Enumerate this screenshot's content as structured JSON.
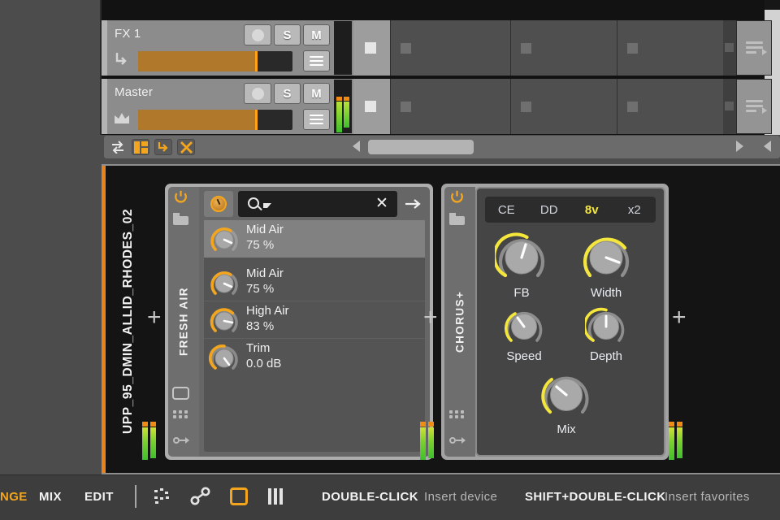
{
  "window": {
    "accent_orange": "#f3a61d",
    "accent_yellow": "#f5e63c"
  },
  "mixer": {
    "tracks": [
      {
        "name": "FX 1",
        "icon": "arrow-down-bend-icon",
        "rec_label": "",
        "solo_label": "S",
        "mute_label": "M",
        "menu_label": "list-icon",
        "fader_percent": 76,
        "meter_active": false
      },
      {
        "name": "Master",
        "icon": "crown-icon",
        "rec_label": "",
        "solo_label": "S",
        "mute_label": "M",
        "menu_label": "list-icon",
        "fader_percent": 76,
        "meter_active": true
      }
    ]
  },
  "toolbar": {
    "icons": [
      {
        "name": "swap-arrows-icon",
        "active": false
      },
      {
        "name": "track-list-icon",
        "active": true
      },
      {
        "name": "arrow-down-bend-icon",
        "active": false
      },
      {
        "name": "close-x-icon",
        "active": false
      }
    ],
    "scroll_left_label": "◀",
    "scroll_right_label": "▶",
    "scroll_right2_label": "◀"
  },
  "rack": {
    "track_name": "UPP_95_DMIN_ALLID_RHODES_02",
    "add_device_label": "+",
    "devices": [
      {
        "label": "FRESH AIR",
        "power_on": true,
        "search": {
          "value": "",
          "placeholder": "",
          "clear_label": "✕",
          "dropdown_icon": "search-dropdown-icon",
          "expand_label": "→"
        },
        "params": [
          {
            "name": "Mid Air",
            "value": "75 %",
            "knob_percent": 75,
            "selected": true
          },
          {
            "name": "Mid Air",
            "value": "75 %",
            "knob_percent": 75,
            "selected": false
          },
          {
            "name": "High Air",
            "value": "83 %",
            "knob_percent": 83,
            "selected": false
          },
          {
            "name": "Trim",
            "value": "0.0 dB",
            "knob_percent": 50,
            "selected": false
          }
        ]
      },
      {
        "label": "CHORUS+",
        "power_on": true,
        "modes": [
          {
            "label": "CE",
            "active": false
          },
          {
            "label": "DD",
            "active": false
          },
          {
            "label": "8v",
            "active": true
          },
          {
            "label": "x2",
            "active": false
          }
        ],
        "knobs": [
          {
            "label": "FB",
            "percent": 48
          },
          {
            "label": "Width",
            "percent": 68
          },
          {
            "label": "Speed",
            "percent": 28
          },
          {
            "label": "Depth",
            "percent": 50
          },
          {
            "label": "Mix",
            "percent": 33
          }
        ]
      }
    ]
  },
  "statusbar": {
    "items": [
      {
        "label": "NGE",
        "style": "orange"
      },
      {
        "label": "MIX",
        "style": "white"
      },
      {
        "label": "EDIT",
        "style": "white"
      }
    ],
    "icons": [
      {
        "name": "scatter-dots-icon",
        "active": false
      },
      {
        "name": "link-chain-icon",
        "active": false
      },
      {
        "name": "rounded-square-icon",
        "active": true
      },
      {
        "name": "three-bars-icon",
        "active": false
      }
    ],
    "hints": [
      {
        "key": "DOUBLE-CLICK",
        "action": "Insert device"
      },
      {
        "key": "SHIFT+DOUBLE-CLICK",
        "action": "Insert favorites"
      }
    ]
  }
}
